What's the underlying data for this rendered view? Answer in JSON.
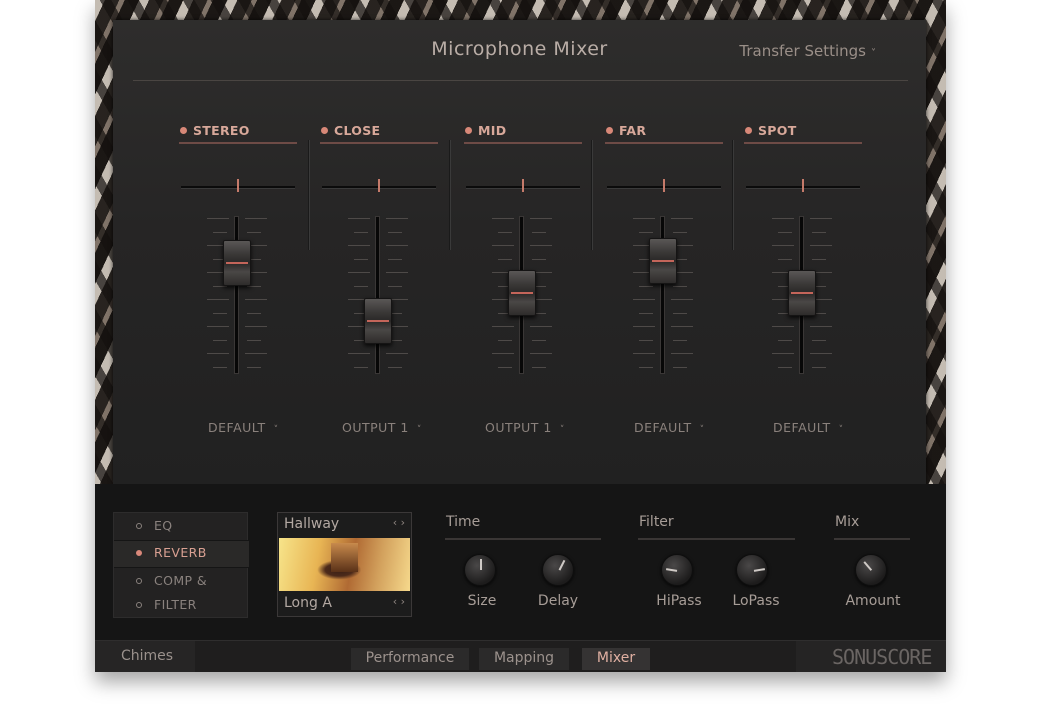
{
  "panel": {
    "title": "Microphone Mixer",
    "transfer_label": "Transfer Settings",
    "transfer_chevron": "˅"
  },
  "channels": [
    {
      "name": "STEREO",
      "output": "DEFAULT",
      "pan": 0.5,
      "level": 0.76
    },
    {
      "name": "CLOSE",
      "output": "OUTPUT 1",
      "pan": 0.5,
      "level": 0.29
    },
    {
      "name": "MID",
      "output": "OUTPUT 1",
      "pan": 0.5,
      "level": 0.52
    },
    {
      "name": "FAR",
      "output": "DEFAULT",
      "pan": 0.5,
      "level": 0.78
    },
    {
      "name": "SPOT",
      "output": "DEFAULT",
      "pan": 0.5,
      "level": 0.52
    }
  ],
  "output_chevron": "˅",
  "fx_menu": {
    "items": [
      {
        "label": "EQ",
        "selected": false
      },
      {
        "label": "REVERB",
        "selected": true
      },
      {
        "label": "COMP &",
        "selected": false
      },
      {
        "label": "FILTER",
        "selected": false
      }
    ]
  },
  "preset": {
    "type": "Hallway",
    "variant": "Long A",
    "arrows": "‹ ›"
  },
  "groups": {
    "time": {
      "title": "Time",
      "knobs": [
        {
          "label": "Size",
          "value": 0.5
        },
        {
          "label": "Delay",
          "value": 0.6
        }
      ]
    },
    "filter": {
      "title": "Filter",
      "knobs": [
        {
          "label": "HiPass",
          "value": 0.2
        },
        {
          "label": "LoPass",
          "value": 0.8
        }
      ]
    },
    "mix": {
      "title": "Mix",
      "knobs": [
        {
          "label": "Amount",
          "value": 0.35
        }
      ]
    }
  },
  "tabbar": {
    "instrument": "Chimes",
    "tabs": [
      {
        "label": "Performance",
        "active": false
      },
      {
        "label": "Mapping",
        "active": false
      },
      {
        "label": "Mixer",
        "active": true
      }
    ],
    "logo": "SONUSCORE"
  },
  "colors": {
    "accent": "#d88878",
    "panel": "#2a2929",
    "text": "#a79d97"
  }
}
